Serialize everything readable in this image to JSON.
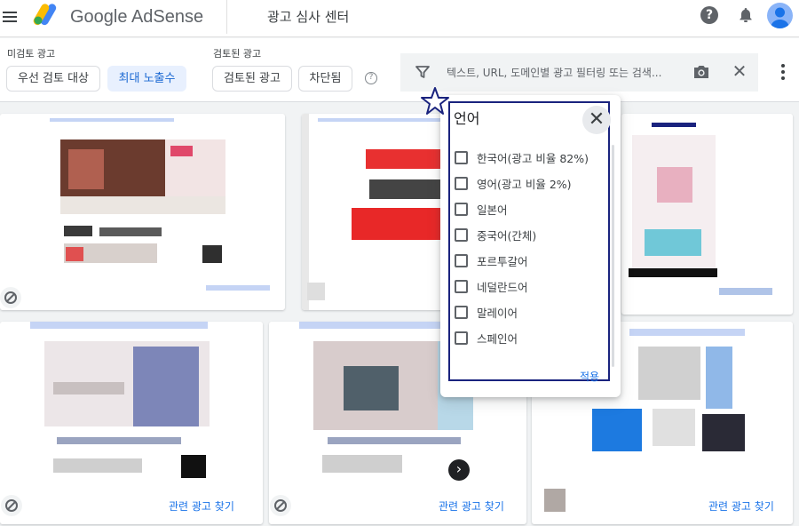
{
  "app": {
    "brand": "Google AdSense",
    "page_title": "광고 심사 센터"
  },
  "icons": {
    "menu": "hamburger-menu-icon",
    "help": "help-icon",
    "notifications": "bell-icon",
    "account": "avatar"
  },
  "filters": {
    "unreviewed_label": "미검토 광고",
    "reviewed_label": "검토된 광고",
    "chips": {
      "priority": "우선 검토 대상",
      "max_impressions": "최대 노출수",
      "reviewed": "검토된 광고",
      "blocked": "차단됨"
    },
    "search_placeholder": "텍스트, URL, 도메인별 광고 필터링 또는 검색..."
  },
  "cards": {
    "related_link": "관련 광고 찾기"
  },
  "language_popup": {
    "title": "언어",
    "languages": [
      "한국어(광고 비율 82%)",
      "영어(광고 비율 2%)",
      "일본어",
      "중국어(간체)",
      "포르투갈어",
      "네덜란드어",
      "말레이어",
      "스페인어"
    ],
    "apply_label": "적용"
  },
  "colors": {
    "accent": "#1a73e8",
    "active_chip_bg": "#e8f0fe",
    "highlight_frame": "#1a237e"
  }
}
